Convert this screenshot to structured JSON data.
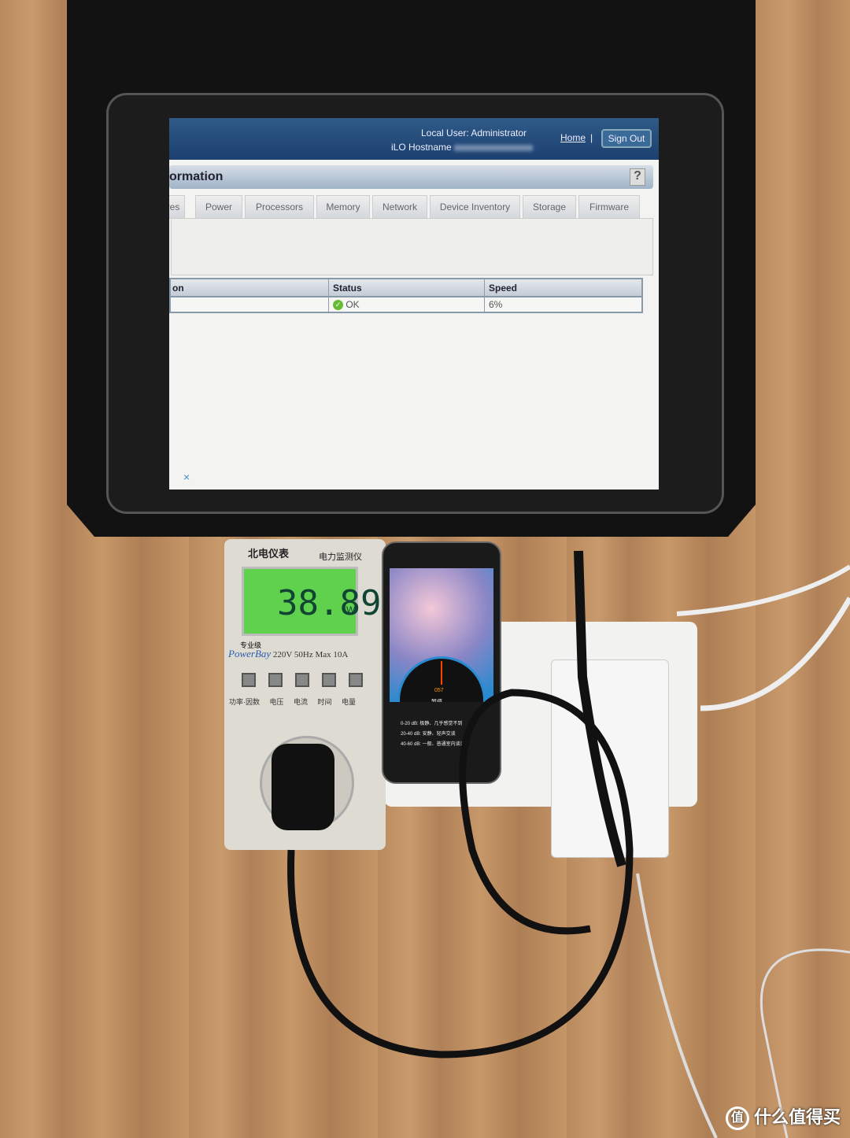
{
  "ilo": {
    "local_user": "Local User:  Administrator",
    "hostname_label": "iLO Hostname",
    "home": "Home",
    "separator": "|",
    "sign_out": "Sign Out",
    "page_title": "ormation",
    "help": "?",
    "tabs": [
      "res",
      "Power",
      "Processors",
      "Memory",
      "Network",
      "Device Inventory",
      "Storage",
      "Firmware"
    ],
    "table": {
      "headers": [
        "on",
        "Status",
        "Speed"
      ],
      "row": {
        "status": "OK",
        "speed": "6%"
      }
    },
    "close": "×"
  },
  "power_meter": {
    "brand": "北电仪表",
    "product": "电力监测仪",
    "reading": "38.89",
    "unit": "W",
    "grade": "专业级",
    "model": "PowerBay",
    "specs": "220V  50Hz  Max 10A",
    "buttons": "功率·因数 电压 电流 时间 电量"
  },
  "phone": {
    "reading": "057",
    "button": "暂停",
    "legend": [
      "0-20 dB:  极静、几乎感觉不到",
      "20-40 dB:  安静、轻声交谈",
      "40-60 dB:  一般、普通室内谈话"
    ]
  },
  "watermark": {
    "icon": "值",
    "text": "什么值得买"
  }
}
